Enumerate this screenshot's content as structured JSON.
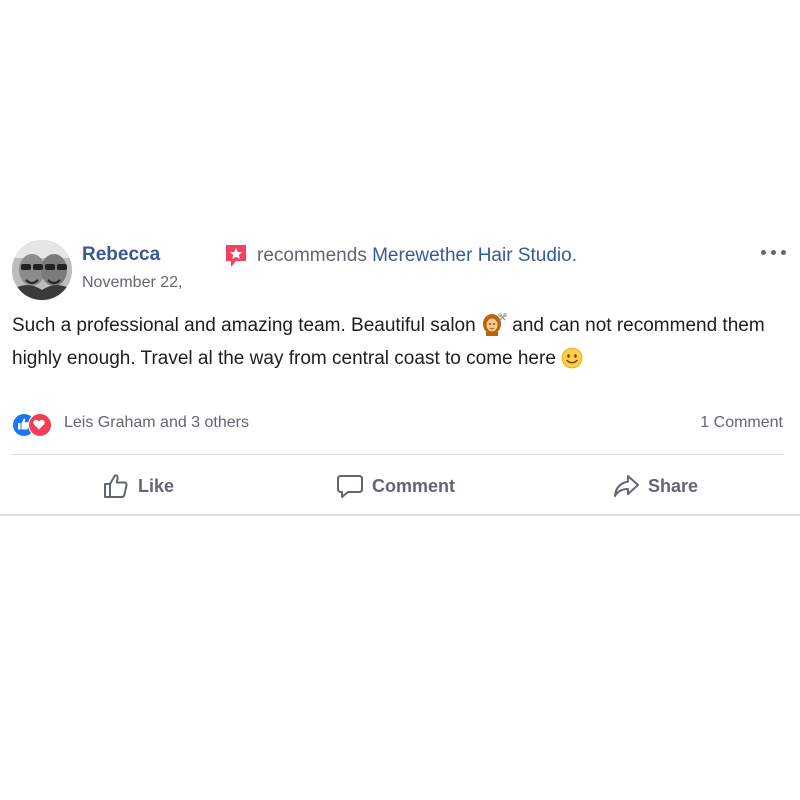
{
  "post": {
    "author": "Rebecca",
    "recommend_prefix": "recommends",
    "page_name": "Merewether Hair Studio.",
    "date": "November 22,",
    "text_part1": "Such a professional and amazing team. Beautiful salon",
    "text_part2": " and can not recommend them highly enough. Travel al the way from central coast to come here ",
    "emoji_1": "woman-getting-haircut-icon",
    "emoji_2": "slightly-smiling-face-icon"
  },
  "reactions": {
    "summary": "Leis Graham and 3 others",
    "types": [
      "like",
      "love"
    ],
    "comment_count": "1 Comment"
  },
  "actions": {
    "like_label": "Like",
    "comment_label": "Comment",
    "share_label": "Share"
  },
  "colors": {
    "link": "#385898",
    "secondary_text": "#606770",
    "like_blue": "#1877f2",
    "love_red": "#f33e58",
    "recommend_badge": "#f3425f"
  }
}
